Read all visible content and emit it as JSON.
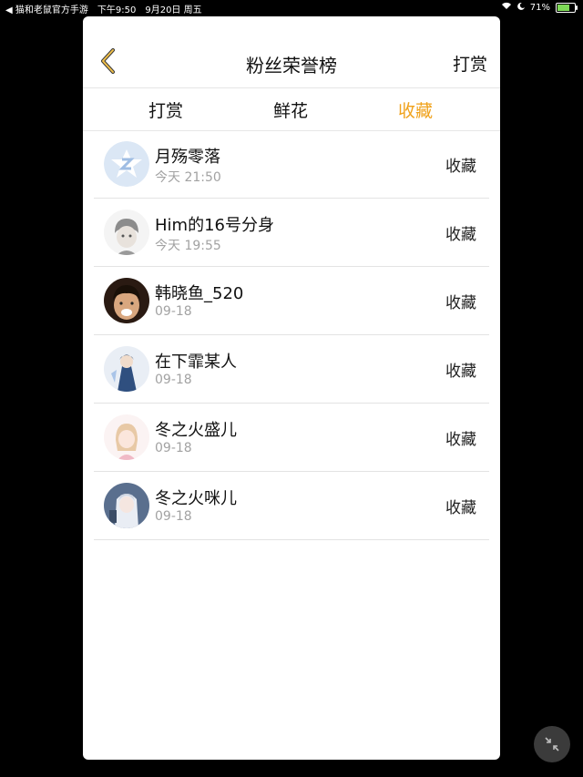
{
  "status": {
    "back_app": "◀ 猫和老鼠官方手游",
    "time": "下午9:50",
    "date": "9月20日 周五",
    "battery": "71%"
  },
  "header": {
    "title": "粉丝荣誉榜",
    "action": "打赏"
  },
  "tabs": [
    {
      "label": "打赏"
    },
    {
      "label": "鲜花"
    },
    {
      "label": "收藏"
    }
  ],
  "rows": [
    {
      "name": "月殇零落",
      "time": "今天 21:50",
      "action": "收藏"
    },
    {
      "name": "Him的16号分身",
      "time": "今天 19:55",
      "action": "收藏"
    },
    {
      "name": "韩晓鱼_520",
      "time": "09-18",
      "action": "收藏"
    },
    {
      "name": "在下霏某人",
      "time": "09-18",
      "action": "收藏"
    },
    {
      "name": "冬之火盛儿",
      "time": "09-18",
      "action": "收藏"
    },
    {
      "name": "冬之火咪儿",
      "time": "09-18",
      "action": "收藏"
    }
  ],
  "colors": {
    "accent": "#f0a21b",
    "background": "#000000",
    "panel": "#ffffff"
  }
}
